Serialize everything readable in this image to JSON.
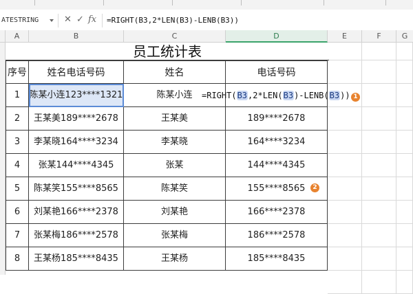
{
  "formula_bar": {
    "name_box": "ATESTRING",
    "cancel_glyph": "✕",
    "enter_glyph": "✓",
    "fx_label": "fx",
    "formula": "=RIGHT(B3,2*LEN(B3)-LENB(B3))"
  },
  "columns": [
    "A",
    "B",
    "C",
    "D",
    "E",
    "F",
    "G"
  ],
  "sheet_title": "员工统计表",
  "headers": [
    "序号",
    "姓名电话号码",
    "姓名",
    "电话号码"
  ],
  "rows": [
    {
      "no": "1",
      "name_phone": "陈某小连123****1321",
      "name": "陈某小连",
      "phone": ""
    },
    {
      "no": "2",
      "name_phone": "王某美189****2678",
      "name": "王某美",
      "phone": "189****2678"
    },
    {
      "no": "3",
      "name_phone": "李某晓164****3234",
      "name": "李某晓",
      "phone": "164****3234"
    },
    {
      "no": "4",
      "name_phone": "张某144****4345",
      "name": "张某",
      "phone": "144****4345"
    },
    {
      "no": "5",
      "name_phone": "陈某笑155****8565",
      "name": "陈某笑",
      "phone": "155****8565"
    },
    {
      "no": "6",
      "name_phone": "刘某艳166****2378",
      "name": "刘某艳",
      "phone": "166****2378"
    },
    {
      "no": "7",
      "name_phone": "张某梅186****2578",
      "name": "张某梅",
      "phone": "186****2578"
    },
    {
      "no": "8",
      "name_phone": "王某杨185****8435",
      "name": "王某杨",
      "phone": "185****8435"
    }
  ],
  "editing_formula": {
    "prefix": "=RIGHT(",
    "ref1": "B3",
    "mid1": ",2*LEN(",
    "ref2": "B3",
    "mid2": ")-LENB(",
    "ref3": "B3",
    "suffix": "))"
  },
  "badges": {
    "first": "1",
    "second": "2"
  },
  "colors": {
    "selection": "#5b8bd6",
    "active_col": "#3aa36a",
    "badge": "#e8832f",
    "ref_highlight": "#c9d7f2"
  }
}
